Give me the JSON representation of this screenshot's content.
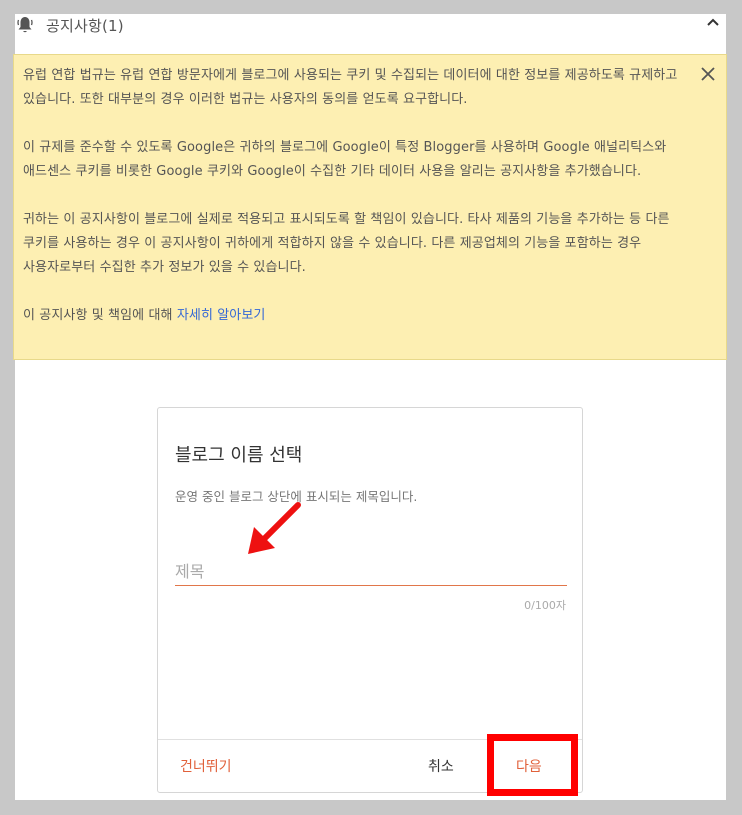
{
  "notice": {
    "title": "공지사항(1)",
    "icons": {
      "bell": "bell-icon",
      "collapse": "chevron-up-icon",
      "close": "close-icon"
    },
    "paragraphs": [
      "유럽 연합 법규는 유럽 연합 방문자에게 블로그에 사용되는 쿠키 및 수집되는 데이터에 대한 정보를 제공하도록 규제하고 있습니다. 또한 대부분의 경우 이러한 법규는 사용자의 동의를 얻도록 요구합니다.",
      "이 규제를 준수할 수 있도록 Google은 귀하의 블로그에 Google이 특정 Blogger를 사용하며 Google 애널리틱스와 애드센스 쿠키를 비롯한 Google 쿠키와 Google이 수집한 기타 데이터 사용을 알리는 공지사항을 추가했습니다.",
      "귀하는 이 공지사항이 블로그에 실제로 적용되고 표시되도록 할 책임이 있습니다. 타사 제품의 기능을 추가하는 등 다른 쿠키를 사용하는 경우 이 공지사항이 귀하에게 적합하지 않을 수 있습니다. 다른 제공업체의 기능을 포함하는 경우 사용자로부터 수집한 추가 정보가 있을 수 있습니다."
    ],
    "learn_more_prefix": "이 공지사항 및 책임에 대해 ",
    "learn_more_link": "자세히 알아보기"
  },
  "dialog": {
    "title": "블로그 이름 선택",
    "subtitle": "운영 중인 블로그 상단에 표시되는 제목입니다.",
    "input_placeholder": "제목",
    "input_value": "",
    "counter": "0/100자",
    "skip_label": "건너뛰기",
    "cancel_label": "취소",
    "next_label": "다음"
  },
  "colors": {
    "accent": "#e1613b",
    "notice_bg": "#fdefb2",
    "link": "#3367d6",
    "highlight": "#ff0000"
  }
}
